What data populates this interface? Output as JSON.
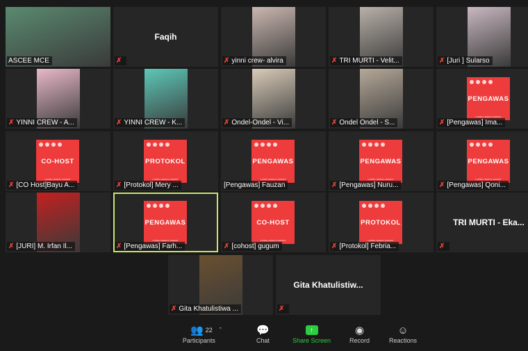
{
  "tiles": [
    {
      "name": "ASCEE MCE",
      "type": "video",
      "muted": false,
      "bg": "#5a8a70"
    },
    {
      "name": "",
      "big": "Faqih",
      "type": "name",
      "muted": true
    },
    {
      "name": "yinni crew- alvira",
      "type": "video",
      "muted": true,
      "bg": "#cbb7b0"
    },
    {
      "name": "TRI MURTI - Velit...",
      "type": "video",
      "muted": true,
      "bg": "#b8b0a8"
    },
    {
      "name": "[Juri ] Sularso",
      "type": "video",
      "muted": true,
      "bg": "#c9b8c0"
    },
    {
      "name": "YINNI CREW - A...",
      "type": "video",
      "muted": true,
      "bg": "#e8b8c8"
    },
    {
      "name": "YINNI CREW - K...",
      "type": "video",
      "muted": true,
      "bg": "#5cc8b8"
    },
    {
      "name": "Ondel-Ondel - Vi...",
      "type": "video",
      "muted": true,
      "bg": "#d8cbb8"
    },
    {
      "name": "Ondel Ondel - S...",
      "type": "video",
      "muted": true,
      "bg": "#b5a898"
    },
    {
      "name": "[Pengawas] Ima...",
      "type": "badge",
      "badge": "PENGAWAS",
      "muted": true
    },
    {
      "name": "[CO Host]Bayu A...",
      "type": "badge",
      "badge": "CO-HOST",
      "muted": true
    },
    {
      "name": "[Protokol] Mery ...",
      "type": "badge",
      "badge": "PROTOKOL",
      "muted": true
    },
    {
      "name": "[Pengawas] Fauzan",
      "type": "badge",
      "badge": "PENGAWAS",
      "muted": false
    },
    {
      "name": "[Pengawas] Nuru...",
      "type": "badge",
      "badge": "PENGAWAS",
      "muted": true
    },
    {
      "name": "[Pengawas] Qoni...",
      "type": "badge",
      "badge": "PENGAWAS",
      "muted": true
    },
    {
      "name": "[JURI] M. Irfan Il...",
      "type": "video",
      "muted": true,
      "bg": "#c42020"
    },
    {
      "name": "[Pengawas] Farh...",
      "type": "badge",
      "badge": "PENGAWAS",
      "muted": true,
      "active": true
    },
    {
      "name": "[cohost] gugum",
      "type": "badge",
      "badge": "CO-HOST",
      "muted": true
    },
    {
      "name": "[Protokol] Febria...",
      "type": "badge",
      "badge": "PROTOKOL",
      "muted": true
    },
    {
      "name": "",
      "big": "TRI MURTI - Eka...",
      "type": "name",
      "muted": true
    },
    {
      "name": "Gita Khatulistiwa ...",
      "type": "video",
      "muted": true,
      "bg": "#6a5030"
    },
    {
      "name": "",
      "big": "Gita  Khatulistiw...",
      "type": "name",
      "muted": true
    }
  ],
  "badge_footer": "LOMBA CERDAS CERMAT",
  "toolbar": {
    "participants_label": "Participants",
    "participants_count": "22",
    "chat_label": "Chat",
    "share_label": "Share Screen",
    "record_label": "Record",
    "reactions_label": "Reactions"
  },
  "colors": {
    "accent_green": "#2ecc40",
    "badge_red": "#ee3b3b",
    "active_border": "#c9e86a",
    "muted_red": "#e8453c"
  }
}
